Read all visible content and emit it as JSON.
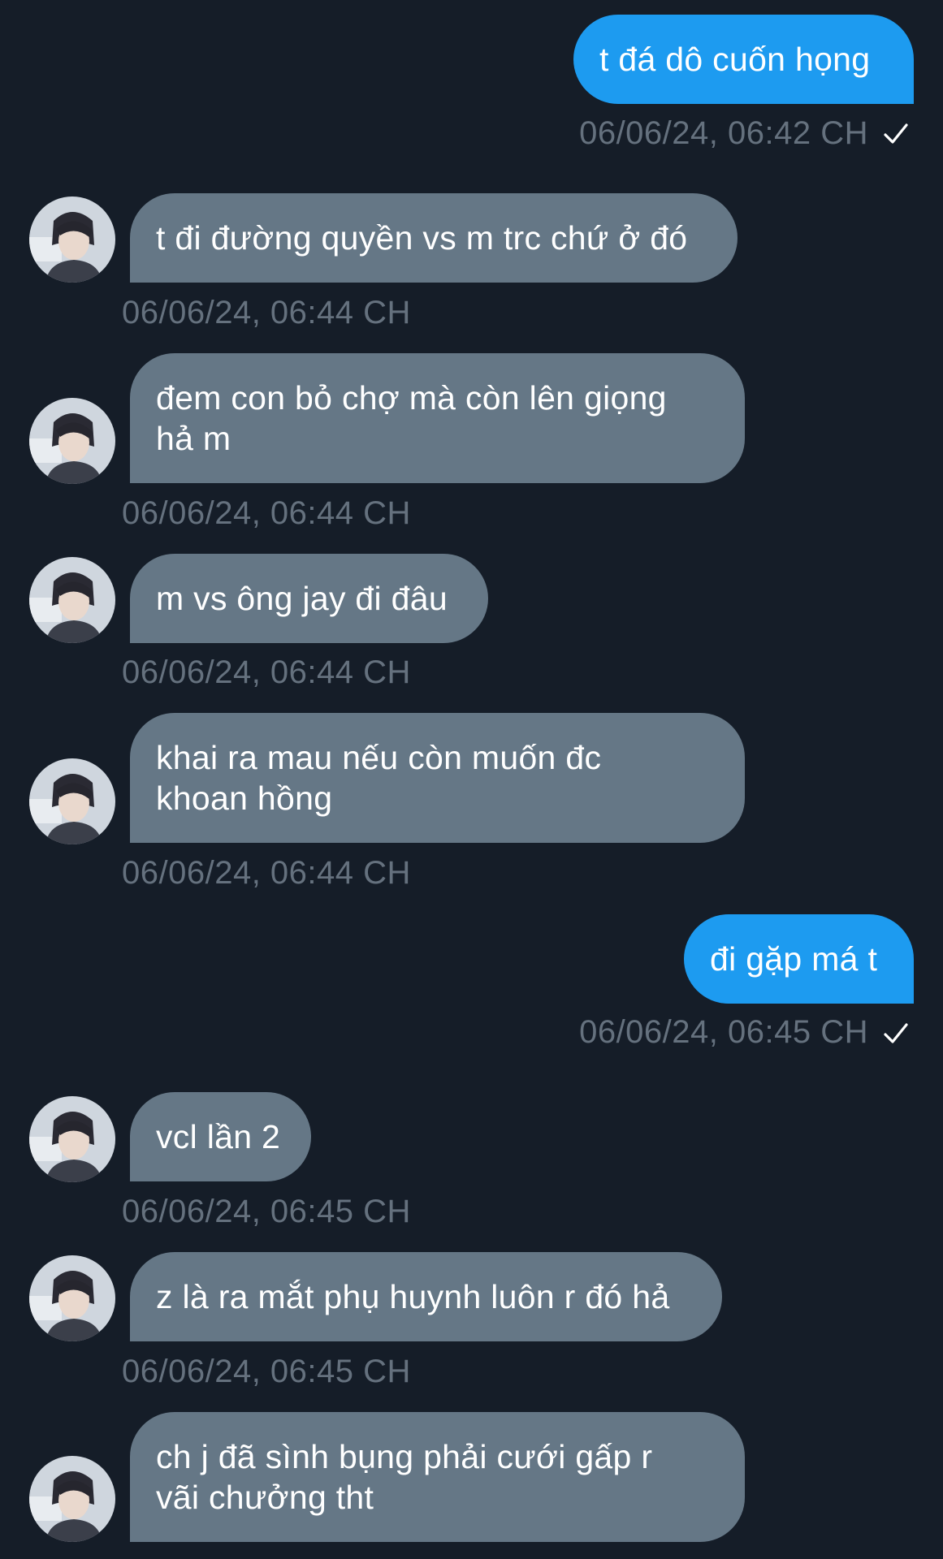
{
  "colors": {
    "background": "#151d28",
    "outgoing_bubble": "#1d9bf0",
    "incoming_bubble": "#657786",
    "timestamp": "#65717e",
    "text": "#ffffff"
  },
  "messages": [
    {
      "direction": "out",
      "lines": [
        "t đá dô cuốn họng"
      ],
      "time": "06/06/24, 06:42 CH",
      "status": "sent-check-icon"
    },
    {
      "direction": "in",
      "lines": [
        "t đi đường quyền vs m trc chứ ở đó"
      ],
      "time": "06/06/24, 06:44 CH",
      "avatar": "user-avatar"
    },
    {
      "direction": "in",
      "lines": [
        "đem con bỏ chợ mà còn lên giọng",
        "hả m"
      ],
      "time": "06/06/24, 06:44 CH",
      "avatar": "user-avatar"
    },
    {
      "direction": "in",
      "lines": [
        "m vs ông jay đi đâu"
      ],
      "time": "06/06/24, 06:44 CH",
      "avatar": "user-avatar"
    },
    {
      "direction": "in",
      "lines": [
        "khai ra mau nếu còn muốn đc",
        "khoan hồng"
      ],
      "time": "06/06/24, 06:44 CH",
      "avatar": "user-avatar"
    },
    {
      "direction": "out",
      "lines": [
        "đi gặp má t"
      ],
      "time": "06/06/24, 06:45 CH",
      "status": "sent-check-icon"
    },
    {
      "direction": "in",
      "lines": [
        "vcl lần 2"
      ],
      "time": "06/06/24, 06:45 CH",
      "avatar": "user-avatar"
    },
    {
      "direction": "in",
      "lines": [
        "z là ra mắt phụ huynh luôn r đó hả"
      ],
      "time": "06/06/24, 06:45 CH",
      "avatar": "user-avatar"
    },
    {
      "direction": "in",
      "lines": [
        "ch j đã sình bụng phải cưới gấp r",
        "vãi chưởng tht"
      ],
      "time": "",
      "avatar": "user-avatar"
    }
  ]
}
